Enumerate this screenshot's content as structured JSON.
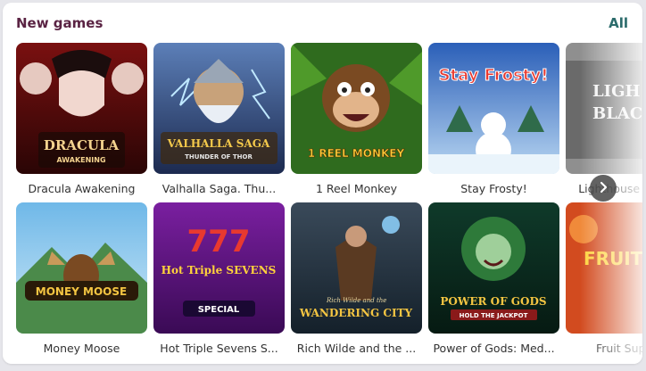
{
  "section": {
    "title": "New games",
    "all_label": "All"
  },
  "games_row1": [
    {
      "label": "Dracula Awakening",
      "art_text": "DRACULA",
      "art_sub": "AWAKENING"
    },
    {
      "label": "Valhalla Saga. Thu...",
      "art_text": "VALHALLA SAGA",
      "art_sub": "THUNDER OF THOR"
    },
    {
      "label": "1 Reel Monkey",
      "art_text": "1 REEL MONKEY",
      "art_sub": ""
    },
    {
      "label": "Stay Frosty!",
      "art_text": "Stay Frosty!",
      "art_sub": ""
    },
    {
      "label": "Lighthouse Black...",
      "art_text": "LIGH",
      "art_sub": "BLAC"
    }
  ],
  "games_row2": [
    {
      "label": "Money Moose",
      "art_text": "MONEY MOOSE",
      "art_sub": ""
    },
    {
      "label": "Hot Triple Sevens S...",
      "art_text": "Hot Triple SEVENS",
      "art_sub": "SPECIAL"
    },
    {
      "label": "Rich Wilde and the ...",
      "art_text": "WANDERING CITY",
      "art_sub": "Rich Wilde and the"
    },
    {
      "label": "Power of Gods: Med...",
      "art_text": "POWER OF GODS",
      "art_sub": "HOLD THE JACKPOT"
    },
    {
      "label": "Fruit Super...",
      "art_text": "FRUIT",
      "art_sub": ""
    }
  ],
  "colors": {
    "title": "#5a2343",
    "link": "#2b6b6b",
    "label": "#333333"
  },
  "icons": {
    "next": "chevron-right-icon"
  }
}
